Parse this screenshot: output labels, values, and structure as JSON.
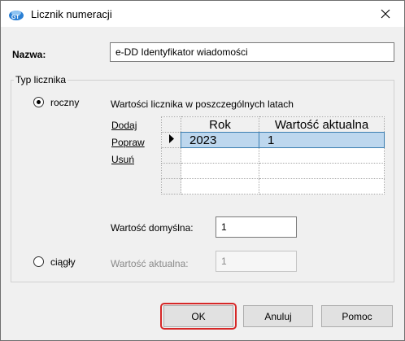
{
  "window": {
    "title": "Licznik numeracji",
    "icon": "licznik-app-icon"
  },
  "name": {
    "label": "Nazwa:",
    "value": "e-DD Identyfikator wiadomości"
  },
  "counter_type": {
    "legend": "Typ licznika",
    "options": [
      {
        "label": "roczny",
        "selected": true
      },
      {
        "label": "ciągły",
        "selected": false
      }
    ]
  },
  "yearly": {
    "caption": "Wartości licznika w poszczególnych latach",
    "actions": [
      "Dodaj",
      "Popraw",
      "Usuń"
    ],
    "columns": [
      "Rok",
      "Wartość aktualna"
    ],
    "rows": [
      {
        "year": "2023",
        "value": "1",
        "selected": true
      }
    ],
    "default_label": "Wartość domyślna:",
    "default_value": "1"
  },
  "continuous": {
    "current_label": "Wartość aktualna:",
    "current_value": "1"
  },
  "buttons": {
    "ok": "OK",
    "cancel": "Anuluj",
    "help": "Pomoc"
  },
  "colors": {
    "selection": "#bdd7ee",
    "highlight": "#d62828"
  }
}
